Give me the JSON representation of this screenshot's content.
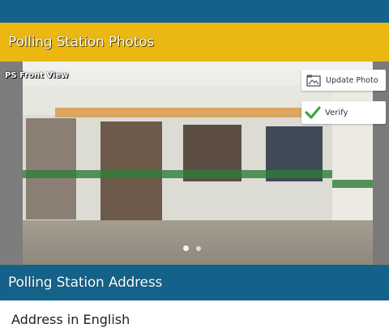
{
  "header": {
    "title": "Polling Station Photos",
    "color": "#eab810"
  },
  "top_bar": {
    "color": "#146289"
  },
  "photo": {
    "label": "PS Front View",
    "update_photo_label": "Update Photo",
    "update_photo_icon": "image-upload-icon",
    "verify_label": "Verify",
    "verify_icon": "checkmark-icon",
    "verify_icon_color": "#3aa641",
    "pager": {
      "total": 2,
      "current": 1
    }
  },
  "address_section": {
    "title": "Polling Station Address",
    "color": "#146289",
    "field_label": "Address in English"
  }
}
